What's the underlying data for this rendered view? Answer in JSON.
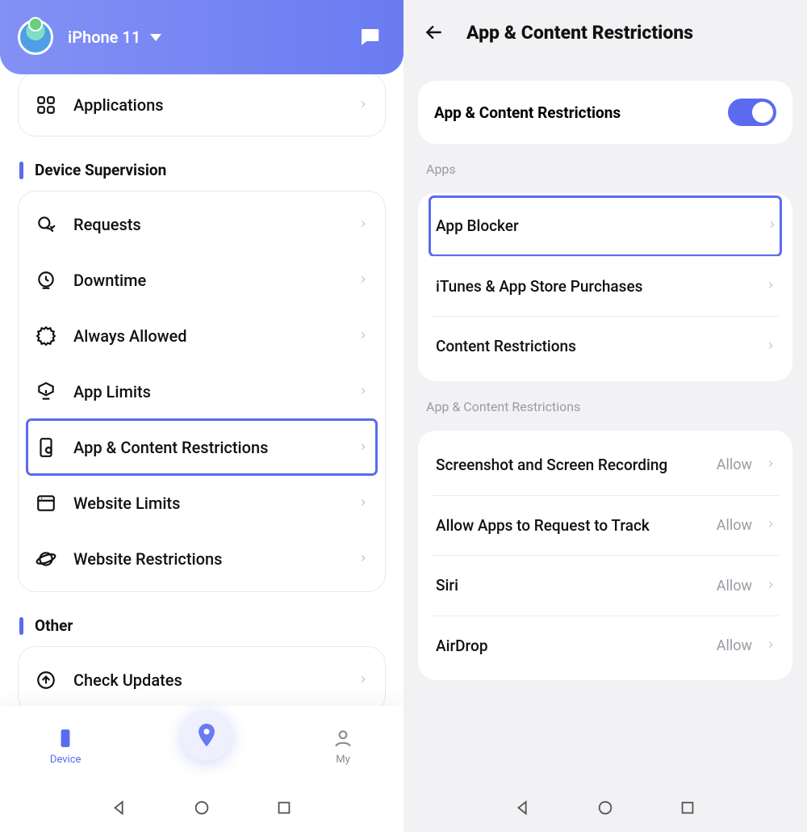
{
  "left": {
    "device_name": "iPhone 11",
    "applications_label": "Applications",
    "sections": {
      "supervision": {
        "title": "Device Supervision",
        "items": [
          {
            "label": "Requests"
          },
          {
            "label": "Downtime"
          },
          {
            "label": "Always Allowed"
          },
          {
            "label": "App Limits"
          },
          {
            "label": "App & Content Restrictions",
            "selected": true
          },
          {
            "label": "Website Limits"
          },
          {
            "label": "Website Restrictions"
          }
        ]
      },
      "other": {
        "title": "Other",
        "items": [
          {
            "label": "Check Updates"
          }
        ]
      }
    },
    "tabs": {
      "device": "Device",
      "my": "My"
    }
  },
  "right": {
    "title": "App & Content Restrictions",
    "master_toggle_label": "App & Content Restrictions",
    "master_toggle_on": true,
    "groups": [
      {
        "label": "Apps",
        "items": [
          {
            "label": "App Blocker",
            "selected": true
          },
          {
            "label": "iTunes & App Store Purchases"
          },
          {
            "label": "Content Restrictions"
          }
        ]
      },
      {
        "label": "App & Content Restrictions",
        "items": [
          {
            "label": "Screenshot and Screen Recording",
            "value": "Allow"
          },
          {
            "label": "Allow Apps to Request to Track",
            "value": "Allow"
          },
          {
            "label": "Siri",
            "value": "Allow"
          },
          {
            "label": "AirDrop",
            "value": "Allow"
          }
        ]
      }
    ]
  }
}
